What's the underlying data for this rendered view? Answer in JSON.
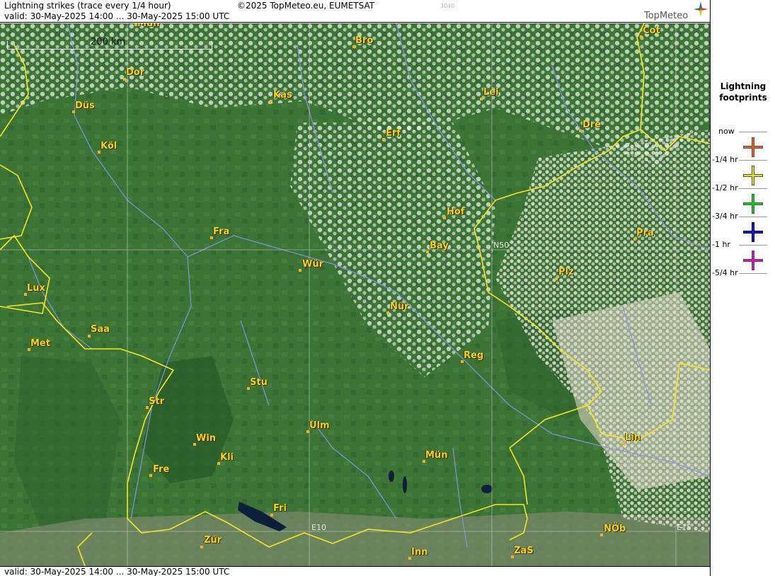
{
  "header": {
    "title": "Lightning strikes (trace every 1/4 hour)",
    "copyright": "©2025 TopMeteo.eu, EUMETSAT",
    "code": "3040",
    "valid": "valid:  30-May-2025 14:00 ... 30-May-2025 15:00 UTC",
    "logo_text": "TopMeteo"
  },
  "footer": {
    "valid": "valid:  30-May-2025 14:00 ... 30-May-2025 15:00 UTC"
  },
  "scale": {
    "label": "200 km"
  },
  "grid": {
    "lat_label": "N50",
    "lon_labels": [
      "E10",
      "E15"
    ]
  },
  "cities": [
    "Mün",
    "Bro",
    "Cot",
    "Dor",
    "Kas",
    "Lei",
    "Düs",
    "Dre",
    "Erf",
    "Köl",
    "Hof",
    "Fra",
    "Pra",
    "Bay",
    "Wür",
    "Plz",
    "Lux",
    "Nür",
    "Saa",
    "Met",
    "Reg",
    "Stu",
    "Str",
    "Ulm",
    "Win",
    "Lin",
    "Kli",
    "Mün",
    "Fre",
    "Fri",
    "NÖb",
    "Zür",
    "ZaS",
    "Inn"
  ],
  "legend": {
    "title_1": "Lightning",
    "title_2": "footprints",
    "now_label": "now",
    "entries": [
      {
        "label": "-1/4 hr",
        "color": "#ff5a00"
      },
      {
        "label": "-1/2 hr",
        "color": "#e8e800"
      },
      {
        "label": "-3/4 hr",
        "color": "#00e000"
      },
      {
        "label": "-1 hr",
        "color": "#0000c8"
      },
      {
        "label": "-5/4 hr",
        "color": "#e000e0"
      }
    ]
  },
  "colors": {
    "land": "#3f7a3a",
    "border": "#f5e61e",
    "river": "#8a92e6",
    "city_label": "#f2d31b"
  }
}
